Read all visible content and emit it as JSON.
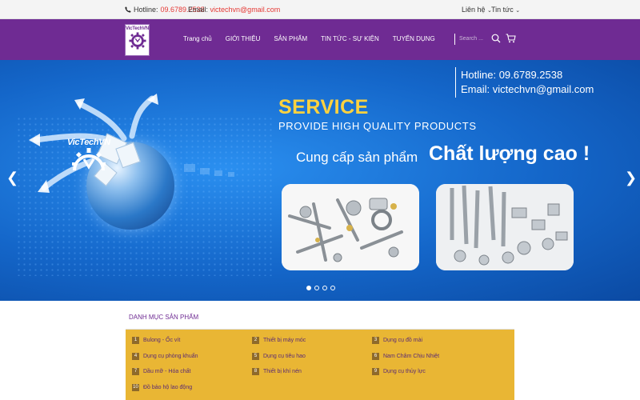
{
  "topbar": {
    "hotline_label": "Hotline:",
    "hotline_value": "09.6789.2538",
    "email_label": "Email:",
    "email_value": "victechvn@gmail.com",
    "menu_contact": "Liên hệ",
    "menu_news": "Tin tức"
  },
  "nav": {
    "logo_text": "VicTechVN",
    "items": [
      {
        "label": "Trang chủ"
      },
      {
        "label": "GIỚI THIỆU"
      },
      {
        "label": "SẢN PHẨM"
      },
      {
        "label": "TIN TỨC - SỰ KIỆN"
      },
      {
        "label": "TUYỂN DỤNG"
      }
    ],
    "search_placeholder": "Search ..."
  },
  "banner": {
    "logo_text": "VicTechVN",
    "hotline": "Hotline: 09.6789.2538",
    "email": "Email: victechvn@gmail.com",
    "service": "SERVICE",
    "provide": "PROVIDE HIGH QUALITY PRODUCTS",
    "cung_cap": "Cung cấp sản phẩm",
    "chat_luong": "Chất lượng cao !"
  },
  "categories": {
    "title": "DANH MỤC SẢN PHẨM",
    "items": [
      {
        "num": "1",
        "label": "Bulong - Ốc vít"
      },
      {
        "num": "2",
        "label": "Thiết bị máy móc"
      },
      {
        "num": "3",
        "label": "Dụng cụ đồ mài"
      },
      {
        "num": "4",
        "label": "Dụng cụ phòng khuẩn"
      },
      {
        "num": "5",
        "label": "Dụng cụ tiêu hao"
      },
      {
        "num": "6",
        "label": "Nam Châm Chịu Nhiệt"
      },
      {
        "num": "7",
        "label": "Dầu mỡ - Hóa chất"
      },
      {
        "num": "8",
        "label": "Thiết bị khí nén"
      },
      {
        "num": "9",
        "label": "Dụng cụ thủy lực"
      },
      {
        "num": "10",
        "label": "Đồ bảo hộ lao động"
      }
    ]
  },
  "colors": {
    "nav_purple": "#6f2b93",
    "banner_blue": "#1466c9",
    "service_yellow": "#ffd23f",
    "category_gold": "#e9b634",
    "accent_red": "#e53935"
  }
}
